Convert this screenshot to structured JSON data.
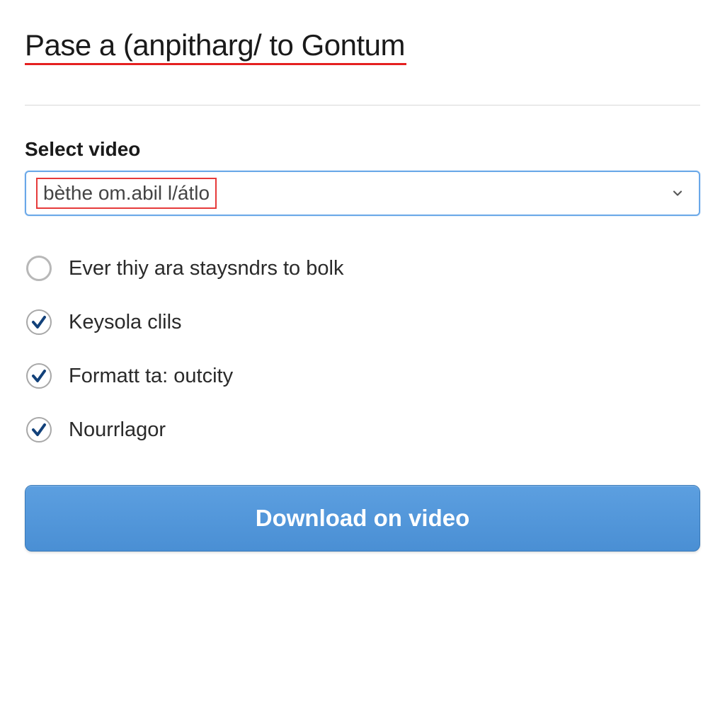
{
  "header": {
    "title": "Pase a (anpitharg/ to Gontum"
  },
  "select": {
    "label": "Select video",
    "value": "bèthe om.abil l/átlo"
  },
  "options": [
    {
      "type": "radio",
      "checked": false,
      "label": "Ever thiy ara staysndrs to bolk"
    },
    {
      "type": "check",
      "checked": true,
      "label": "Keysola clils"
    },
    {
      "type": "check",
      "checked": true,
      "label": "Formatt ta: outcity"
    },
    {
      "type": "check",
      "checked": true,
      "label": "Nourrlagor"
    }
  ],
  "button": {
    "download": "Download on video"
  },
  "colors": {
    "accent_red": "#e52020",
    "accent_blue_border": "#6aa8e8",
    "check_dark_blue": "#12417a",
    "button_blue_top": "#5c9fe0",
    "button_blue_bottom": "#4a8fd4"
  }
}
